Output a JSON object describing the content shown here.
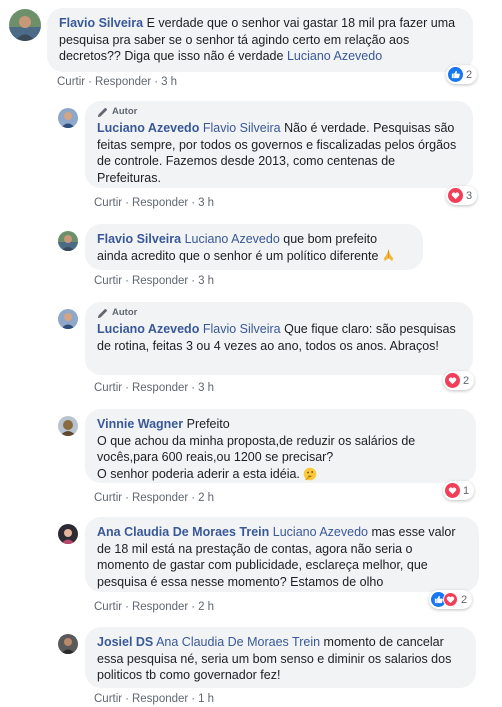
{
  "actions": {
    "like": "Curtir",
    "reply": "Responder",
    "sep": "·"
  },
  "author_badge": "Autor",
  "comments": [
    {
      "name": "Flavio Silveira",
      "text": "E verdade que o senhor vai gastar 18 mil pra fazer uma pesquisa pra saber se o senhor tá agindo certo em relação aos decretos?? Diga que isso não é verdade",
      "mention_after": "Luciano Azevedo",
      "time": "3 h",
      "reaction_count": "2",
      "reactions": [
        "like"
      ]
    },
    {
      "name": "Luciano Azevedo",
      "mention": "Flavio Silveira",
      "text": "Não é verdade. Pesquisas são feitas sempre, por todos os governos e fiscalizadas pelos órgãos de controle. Fazemos desde 2013, como centenas de Prefeituras.",
      "time": "3 h",
      "reaction_count": "3",
      "reactions": [
        "love"
      ]
    },
    {
      "name": "Flavio Silveira",
      "mention": "Luciano Azevedo",
      "text": "que bom prefeito ainda acredito que o senhor é um político diferente",
      "emoji": "folded-hands",
      "time": "3 h"
    },
    {
      "name": "Luciano Azevedo",
      "mention": "Flavio Silveira",
      "text": "Que fique claro: são pesquisas de rotina, feitas 3 ou 4 vezes ao ano, todos os anos. Abraços!",
      "time": "3 h",
      "reaction_count": "2",
      "reactions": [
        "love"
      ]
    },
    {
      "name": "Vinnie Wagner",
      "text_head": "Prefeito",
      "text": "O que achou da minha proposta,de reduzir os salários de vocês,para 600 reais,ou 1200 se precisar?",
      "text2": "O senhor poderia aderir a esta idéia.",
      "emoji": "thinking-face",
      "time": "2 h",
      "reaction_count": "1",
      "reactions": [
        "love"
      ]
    },
    {
      "name": "Ana Claudia De Moraes Trein",
      "mention": "Luciano Azevedo",
      "text": "mas esse valor de 18 mil está na prestação de contas, agora não seria o momento de gastar com publicidade, esclareça melhor, que pesquisa é essa nesse momento? Estamos de olho",
      "time": "2 h",
      "reaction_count": "2",
      "reactions": [
        "like",
        "love"
      ]
    },
    {
      "name": "Josiel DS",
      "mention": "Ana Claudia De Moraes Trein",
      "text": "momento de cancelar essa pesquisa né, seria um bom senso e diminir os salarios dos politicos tb como governador fez!",
      "time": "1 h"
    }
  ],
  "colors": {
    "link": "#385898",
    "bubble": "#f2f3f5",
    "like": "#1877f2",
    "love": "#f33e58",
    "meta": "#606770"
  }
}
